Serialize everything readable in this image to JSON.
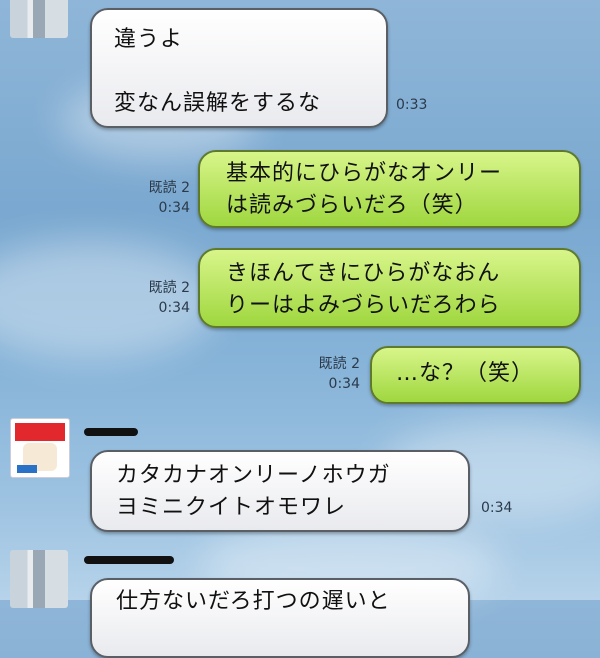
{
  "messages": [
    {
      "lines": [
        "違うよ",
        "",
        "変なん誤解をするな"
      ],
      "time": "0:33"
    },
    {
      "lines": [
        "基本的にひらがなオンリー",
        "は読みづらいだろ（笑）"
      ],
      "read": "既読 2",
      "time": "0:34"
    },
    {
      "lines": [
        "きほんてきにひらがなおん",
        "りーはよみづらいだろわら"
      ],
      "read": "既読 2",
      "time": "0:34"
    },
    {
      "lines": [
        "…な？（笑）"
      ],
      "read": "既読 2",
      "time": "0:34"
    },
    {
      "lines": [
        "カタカナオンリーノホウガ",
        "ヨミニクイトオモワレ"
      ],
      "time": "0:34"
    },
    {
      "lines": [
        "仕方ないだろ打つの遅いと"
      ]
    }
  ],
  "colors": {
    "outgoing": "#b8e65a",
    "incoming": "#f5f5f7"
  }
}
